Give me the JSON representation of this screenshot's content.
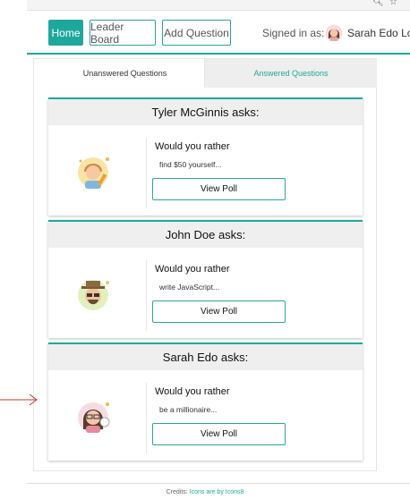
{
  "browser": {
    "icons": [
      "zoom-icon",
      "star-icon"
    ]
  },
  "nav": {
    "items": [
      {
        "label": "Home",
        "active": true
      },
      {
        "label": "Leader Board",
        "active": false
      },
      {
        "label": "Add Question",
        "active": false
      }
    ],
    "signed_in_label": "Signed in as:",
    "user_name": "Sarah Edo",
    "logout_label": "Log"
  },
  "tabs": [
    {
      "label": "Unanswered Questions",
      "active": true
    },
    {
      "label": "Answered Questions",
      "active": false
    }
  ],
  "questions": [
    {
      "author_label": "Tyler McGinnis asks:",
      "prompt": "Would you rather",
      "snippet": "find $50 yourself...",
      "button": "View Poll",
      "avatar": "boy-with-pencil-avatar"
    },
    {
      "author_label": "John Doe asks:",
      "prompt": "Would you rather",
      "snippet": "write JavaScript...",
      "button": "View Poll",
      "avatar": "man-with-hat-glasses-avatar"
    },
    {
      "author_label": "Sarah Edo asks:",
      "prompt": "Would you rather",
      "snippet": "be a millionaire...",
      "button": "View Poll",
      "avatar": "woman-with-glasses-avatar"
    }
  ],
  "footer": {
    "prefix": "Credits:",
    "link": "Icons are by Icons8"
  },
  "colors": {
    "accent": "#1ea89d",
    "annotation_arrow": "#c0392b"
  }
}
